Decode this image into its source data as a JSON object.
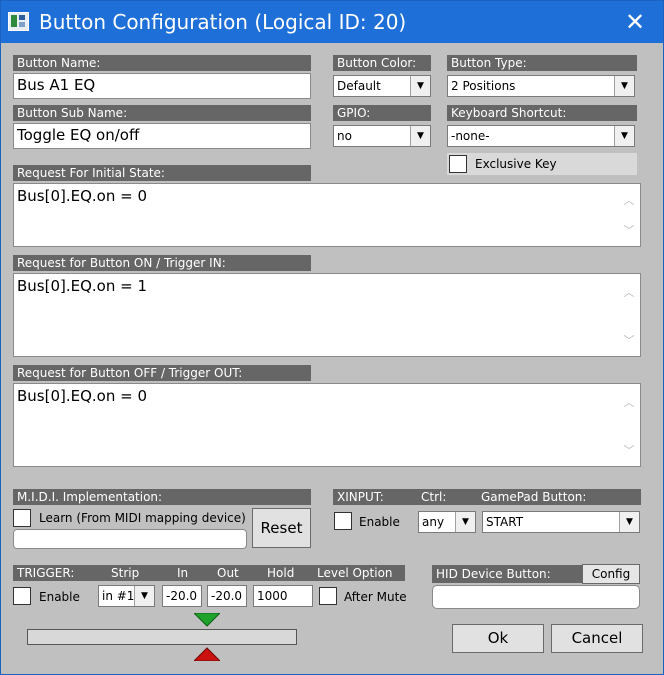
{
  "window": {
    "title": "Button Configuration (Logical ID: 20)"
  },
  "button_name": {
    "label": "Button Name:",
    "value": "Bus A1 EQ"
  },
  "button_color": {
    "label": "Button Color:",
    "value": "Default"
  },
  "button_type": {
    "label": "Button Type:",
    "value": "2 Positions"
  },
  "button_sub_name": {
    "label": "Button Sub Name:",
    "value": "Toggle EQ on/off"
  },
  "gpio": {
    "label": "GPIO:",
    "value": "no"
  },
  "keyboard_shortcut": {
    "label": "Keyboard Shortcut:",
    "value": "-none-"
  },
  "exclusive_key": {
    "label": "Exclusive Key",
    "checked": false
  },
  "initial_state": {
    "label": "Request For Initial State:",
    "value": "Bus[0].EQ.on = 0"
  },
  "button_on": {
    "label": "Request for Button ON / Trigger IN:",
    "value": "Bus[0].EQ.on = 1"
  },
  "button_off": {
    "label": "Request for Button OFF / Trigger OUT:",
    "value": "Bus[0].EQ.on = 0"
  },
  "midi": {
    "label": "M.I.D.I. Implementation:",
    "learn_label": "Learn (From MIDI mapping device)",
    "value": "",
    "reset_label": "Reset"
  },
  "xinput": {
    "label": "XINPUT:",
    "ctrl_label": "Ctrl:",
    "gamepad_label": "GamePad Button:",
    "enable_label": "Enable",
    "ctrl_value": "any",
    "gamepad_value": "START"
  },
  "trigger": {
    "label": "TRIGGER:",
    "strip_label": "Strip",
    "in_label": "In",
    "out_label": "Out",
    "hold_label": "Hold",
    "level_option_label": "Level Option",
    "enable_label": "Enable",
    "strip_value": "in #1",
    "in_value": "-20.0",
    "out_value": "-20.0",
    "hold_value": "1000",
    "after_mute_label": "After Mute"
  },
  "hid": {
    "label": "HID Device Button:",
    "config_label": "Config",
    "value": ""
  },
  "actions": {
    "ok_label": "Ok",
    "cancel_label": "Cancel"
  },
  "colors": {
    "header_bg": "#666666",
    "dialog_bg": "#c0c0c0",
    "titlebar": "#1e6fd8",
    "marker_in": "#1fa32b",
    "marker_out": "#cc1111"
  },
  "icons": {
    "close": "close-icon",
    "dropdown": "chevron-down-icon",
    "scroll_up": "scroll-up-icon",
    "scroll_down": "scroll-down-icon"
  }
}
